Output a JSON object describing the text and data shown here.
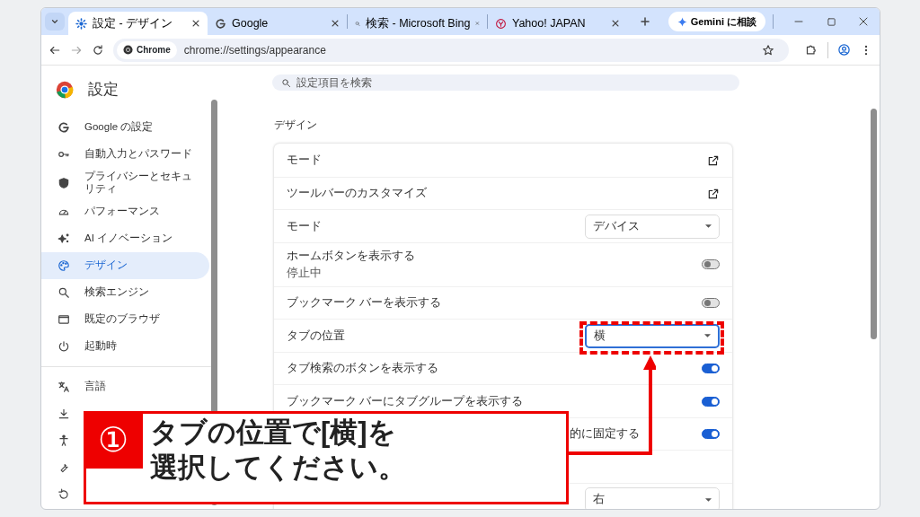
{
  "browser": {
    "tabs": [
      {
        "title": "設定 - デザイン",
        "selected": true
      },
      {
        "title": "Google",
        "selected": false
      },
      {
        "title": "検索 - Microsoft Bing",
        "selected": false
      },
      {
        "title": "Yahoo! JAPAN",
        "selected": false
      }
    ],
    "gemini_button": "Gemini に相談",
    "chip": "Chrome",
    "url": "chrome://settings/appearance"
  },
  "settings": {
    "title": "設定",
    "search_placeholder": "設定項目を検索",
    "sidebar_groups": [
      [
        {
          "label": "Google の設定",
          "selected": false
        },
        {
          "label": "自動入力とパスワード",
          "selected": false
        },
        {
          "label": "プライバシーとセキュリティ",
          "selected": false
        },
        {
          "label": "パフォーマンス",
          "selected": false
        },
        {
          "label": "AI イノベーション",
          "selected": false
        },
        {
          "label": "デザイン",
          "selected": true
        },
        {
          "label": "検索エンジン",
          "selected": false
        },
        {
          "label": "既定のブラウザ",
          "selected": false
        },
        {
          "label": "起動時",
          "selected": false
        }
      ],
      [
        {
          "label": "言語",
          "selected": false
        },
        {
          "selected": false
        },
        {
          "selected": false
        },
        {
          "selected": false
        },
        {
          "selected": false
        }
      ]
    ],
    "section_title": "デザイン",
    "rows": [
      {
        "kind": "link",
        "label": "モード"
      },
      {
        "kind": "link",
        "label": "ツールバーのカスタマイズ"
      },
      {
        "kind": "select",
        "label": "モード",
        "value": "デバイス",
        "focused": false
      },
      {
        "kind": "toggle",
        "label": "ホームボタンを表示する",
        "sublabel": "停止中",
        "on": false
      },
      {
        "kind": "toggle",
        "label": "ブックマーク バーを表示する",
        "on": false
      },
      {
        "kind": "select",
        "label": "タブの位置",
        "value": "横",
        "focused": true
      },
      {
        "kind": "toggle",
        "label": "タブ検索のボタンを表示する",
        "on": true
      },
      {
        "kind": "toggle",
        "label": "ブックマーク バーにタブグループを表示する",
        "on": true
      },
      {
        "kind": "toggle",
        "label": "的に固定する",
        "partial": true,
        "on": true
      },
      {
        "kind": "blank"
      },
      {
        "kind": "select",
        "value": "右",
        "focused": false
      }
    ]
  },
  "callout": {
    "number": "①",
    "lines": [
      "タブの位置で[横]を",
      "選択してください。"
    ]
  }
}
